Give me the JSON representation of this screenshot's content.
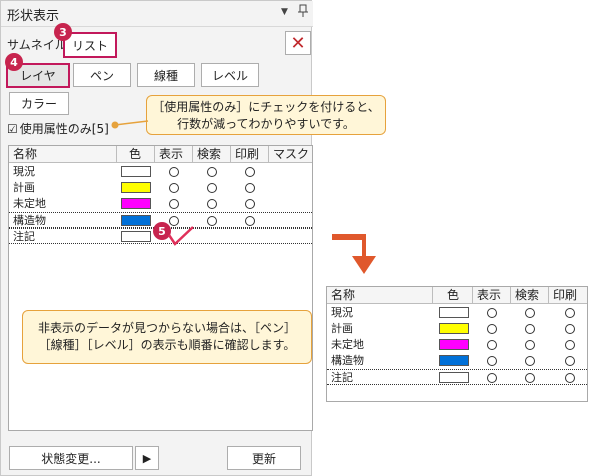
{
  "panel": {
    "title": "形状表示",
    "dropdown_glyph": "▼",
    "pin_glyph": "ᵖ",
    "tabs": {
      "thumbnail": "サムネイル",
      "list": "リスト"
    },
    "close_glyph": "✕",
    "buttons": {
      "layer": "レイヤ",
      "pen": "ペン",
      "linetype": "線種",
      "level": "レベル",
      "color": "カラー"
    },
    "checkbox": {
      "mark": "☑",
      "label": "使用属性のみ[5]"
    },
    "columns": [
      "名称",
      "色",
      "表示",
      "検索",
      "印刷",
      "マスク"
    ],
    "rows": [
      {
        "name": "現況",
        "color": "#ffffff"
      },
      {
        "name": "計画",
        "color": "#ffff00"
      },
      {
        "name": "未定地",
        "color": "#ff00ff"
      },
      {
        "name": "構造物",
        "color": "#0070d8"
      },
      {
        "name": "注記",
        "color": "#ffffff"
      }
    ],
    "bottom": {
      "status_change": "状態変更...",
      "arrow": "▶",
      "update": "更新"
    }
  },
  "badges": {
    "b3": "3",
    "b4": "4",
    "b5": "5"
  },
  "callouts": {
    "top": [
      "［使用属性のみ］にチェックを付けると、",
      "行数が減ってわかりやすいです。"
    ],
    "bottom": [
      "非表示のデータが見つからない場合は、［ペン］",
      "［線種］［レベル］の表示も順番に確認します。"
    ]
  },
  "zoom": {
    "columns": [
      "名称",
      "色",
      "表示",
      "検索",
      "印刷"
    ],
    "rows": [
      {
        "name": "現況",
        "color": "#ffffff"
      },
      {
        "name": "計画",
        "color": "#ffff00"
      },
      {
        "name": "未定地",
        "color": "#ff00ff"
      },
      {
        "name": "構造物",
        "color": "#0070d8"
      },
      {
        "name": "注記",
        "color": "#ffffff"
      }
    ]
  },
  "accent_colors": {
    "badge": "#c7244e",
    "callout_border": "#e6a23c",
    "callout_fill": "#fff6d8",
    "arrow": "#e0582c"
  }
}
